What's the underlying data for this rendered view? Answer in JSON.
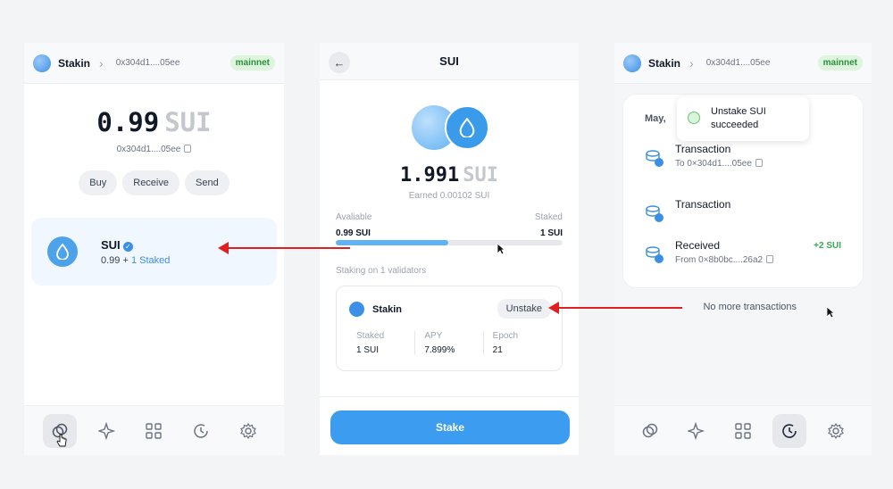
{
  "colors": {
    "accent": "#3b9cf0",
    "success": "#35a853",
    "annotation_arrow": "#e02020",
    "mainnet_badge_bg": "#dcf5dc"
  },
  "wallet_home": {
    "header": {
      "account": "Stakin",
      "address": "0x304d1....05ee",
      "network": "mainnet"
    },
    "balance": {
      "amount": "0.99",
      "unit": "SUI"
    },
    "address": "0x304d1....05ee",
    "actions": [
      "Buy",
      "Receive",
      "Send"
    ],
    "coin": {
      "name": "SUI",
      "amount": "0.99",
      "plus": "+",
      "staked_label": "1 Staked",
      "icon": "sui-drop-icon"
    },
    "nav": [
      "tokens-icon",
      "sparkle-icon",
      "apps-grid-icon",
      "history-icon",
      "settings-gear-icon"
    ],
    "active_nav": 0
  },
  "stake_detail": {
    "title": "SUI",
    "balance": {
      "amount": "1.991",
      "unit": "SUI"
    },
    "earned": "Earned 0.00102 SUI",
    "available_label": "Avaliable",
    "staked_label": "Staked",
    "available_value": "0.99 SUI",
    "staked_value": "1 SUI",
    "available_fraction": 0.497,
    "staking_on": "Staking on 1 validators",
    "validator": {
      "name": "Stakin",
      "unstake_label": "Unstake",
      "stats": [
        {
          "label": "Staked",
          "value": "1 SUI"
        },
        {
          "label": "APY",
          "value": "7.899%"
        },
        {
          "label": "Epoch",
          "value": "21"
        }
      ]
    },
    "stake_button": "Stake"
  },
  "activity": {
    "header": {
      "account": "Stakin",
      "address": "0x304d1....05ee",
      "network": "mainnet"
    },
    "date": "May, ",
    "toast": {
      "text": "Unstake SUI succeeded"
    },
    "transactions": [
      {
        "title": "Transaction",
        "sub": "To 0×304d1....05ee",
        "amount": ""
      },
      {
        "title": "Transaction",
        "sub": "",
        "amount": ""
      },
      {
        "title": "Received",
        "sub": "From 0×8b0bc....26a2",
        "amount": "+2 SUI"
      }
    ],
    "no_more": "No more transactions",
    "active_nav": 3
  }
}
